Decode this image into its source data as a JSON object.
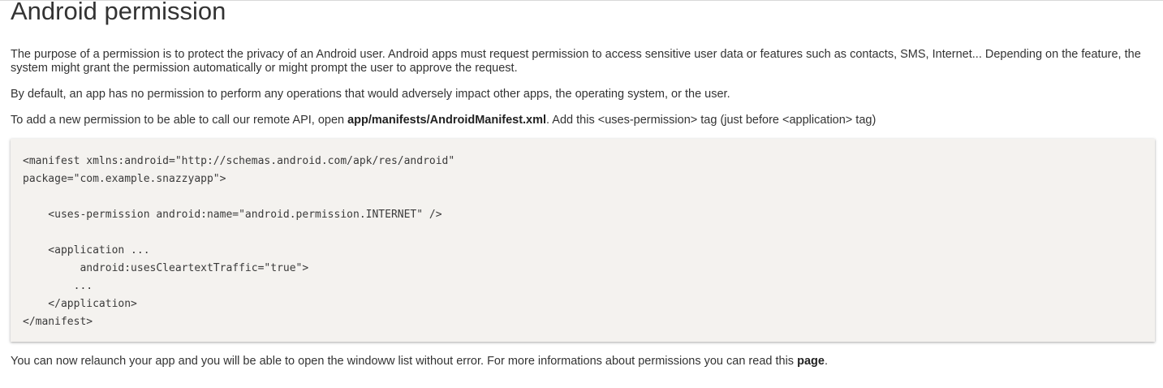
{
  "heading": "Android permission",
  "paragraph1": "The purpose of a permission is to protect the privacy of an Android user. Android apps must request permission to access sensitive user data or features such as contacts, SMS, Internet... Depending on the feature, the system might grant the permission automatically or might prompt the user to approve the request.",
  "paragraph2": "By default, an app has no permission to perform any operations that would adversely impact other apps, the operating system, or the user.",
  "paragraph3": {
    "before": "To add a new permission to be able to call our remote API, open ",
    "file": "app/manifests/AndroidManifest.xml",
    "after": ". Add this <uses-permission> tag (just before <application> tag)"
  },
  "code": {
    "lines": [
      "<manifest xmlns:android=\"http://schemas.android.com/apk/res/android\"",
      "package=\"com.example.snazzyapp\">",
      "",
      "    <uses-permission android:name=\"android.permission.INTERNET\" />",
      "",
      "    <application ...",
      "         android:usesCleartextTraffic=\"true\">",
      "        ...",
      "    </application>",
      "</manifest>"
    ]
  },
  "paragraph4": {
    "before": "You can now relaunch your app and you will be able to open the windoww list without error. For more informations about permissions you can read this ",
    "link": "page",
    "after": "."
  }
}
